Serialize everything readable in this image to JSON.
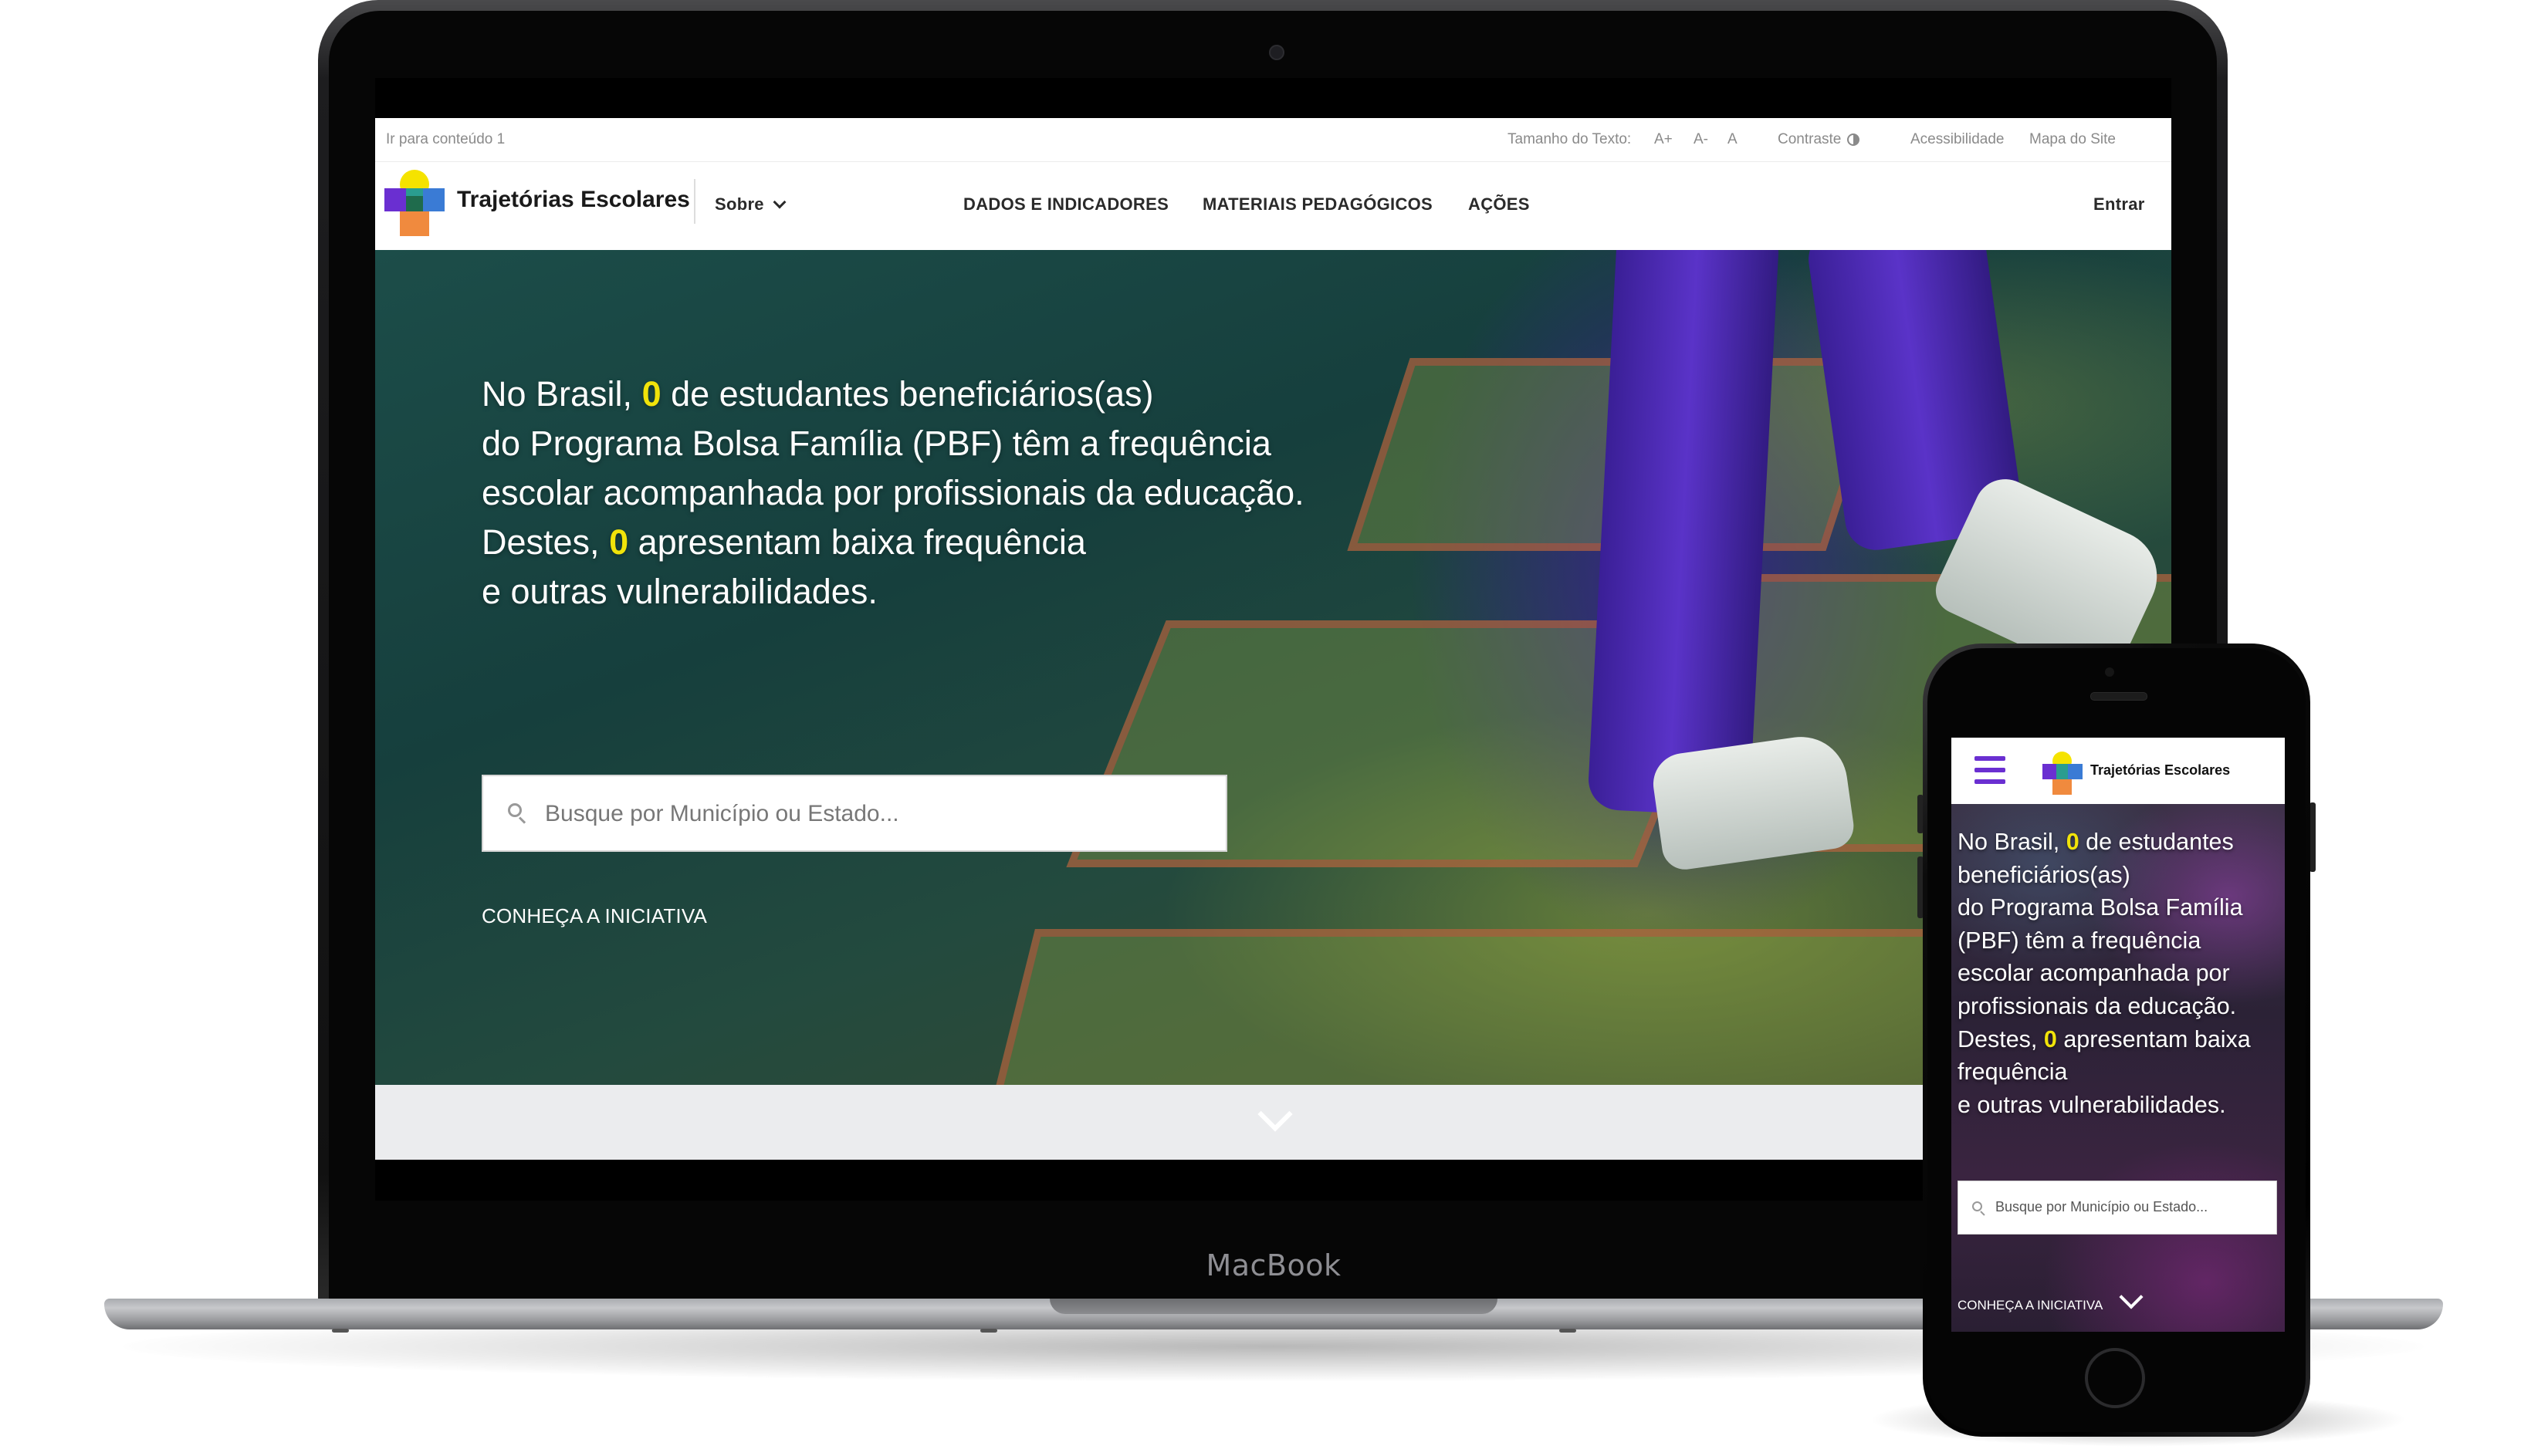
{
  "device_labels": {
    "laptop": "MacBook"
  },
  "desktop_site": {
    "utility_bar": {
      "skip_link": "Ir para conteúdo 1",
      "text_size_label": "Tamanho do Texto:",
      "text_size_increase": "A+",
      "text_size_decrease": "A-",
      "text_size_reset": "A",
      "contrast": "Contraste",
      "accessibility": "Acessibilidade",
      "sitemap": "Mapa do Site"
    },
    "navbar": {
      "brand": "Trajetórias Escolares",
      "about": "Sobre",
      "links": [
        "DADOS E INDICADORES",
        "MATERIAIS PEDAGÓGICOS",
        "AÇÕES"
      ],
      "login": "Entrar"
    },
    "hero": {
      "line1_pre": "No Brasil, ",
      "count_students": "0",
      "line1_post": " de estudantes beneficiários(as)",
      "line2": "do Programa Bolsa Família (PBF) têm a frequência",
      "line3": "escolar acompanhada por profissionais da educação.",
      "line4_pre": "Destes, ",
      "count_low": "0",
      "line4_post": " apresentam baixa frequência",
      "line5": "e outras vulnerabilidades.",
      "search_placeholder": "Busque por Município ou Estado...",
      "cta": "CONHEÇA A INICIATIVA"
    }
  },
  "mobile_site": {
    "brand": "Trajetórias Escolares",
    "hero": {
      "l1_pre": "No Brasil, ",
      "count_students": "0",
      "l1_post": " de estudantes",
      "l2": "beneficiários(as)",
      "l3": "do Programa Bolsa Família",
      "l4": "(PBF) têm a frequência",
      "l5": "escolar acompanhada por",
      "l6": "profissionais da educação.",
      "l7_pre": "Destes, ",
      "count_low": "0",
      "l7_post": " apresentam baixa",
      "l8": "frequência",
      "l9": "e outras vulnerabilidades.",
      "search_placeholder": "Busque por Município ou Estado...",
      "cta": "CONHEÇA A INICIATIVA"
    }
  },
  "colors": {
    "highlight": "#f1e30a",
    "menu_accent": "#6a2fd1",
    "logo": [
      "#f5e300",
      "#6a2fd1",
      "#2a9d8f",
      "#3a7bd5",
      "#f08a3e",
      "#1f6b4c"
    ]
  }
}
